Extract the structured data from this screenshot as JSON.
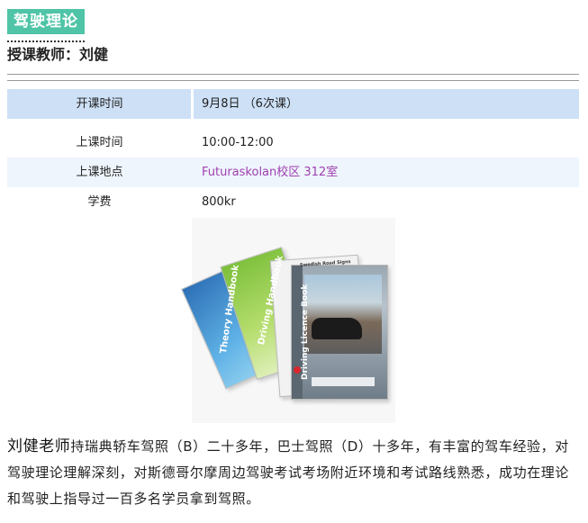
{
  "course": {
    "title": "驾驶理论"
  },
  "teacher": {
    "label": "授课教师：",
    "name": "刘健"
  },
  "info": [
    {
      "label": "开课时间",
      "value": "9月8日 （6次课）"
    },
    {
      "label": "上课时间",
      "value": "10:00-12:00"
    },
    {
      "label": "上课地点",
      "value": "Futuraskolan校区 312室"
    },
    {
      "label": "学费",
      "value": "800kr"
    }
  ],
  "image": {
    "book_titles": [
      "Theory Handbook",
      "Driving Handbook",
      "Swedish Road Signs",
      "Driving Licence Book"
    ]
  },
  "bio": {
    "name": "刘健老师",
    "text": "持瑞典轿车驾照（B）二十多年，巴士驾照（D）十多年，有丰富的驾车经验，对驾驶理论理解深刻，对斯德哥尔摩周边驾驶考试考场附近环境和考试路线熟悉，成功在理论和驾驶上指导过一百多名学员拿到驾照。"
  },
  "colors": {
    "tag_bg": "#4fc4a6",
    "row_highlight": "#cde0f6",
    "row_alt": "#eef5fc",
    "location_text": "#a040b0"
  }
}
